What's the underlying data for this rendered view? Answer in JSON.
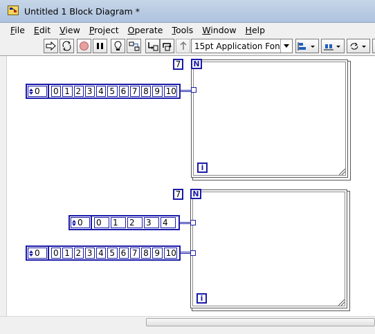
{
  "window": {
    "title": "Untitled 1 Block Diagram *"
  },
  "menu": {
    "items": [
      "File",
      "Edit",
      "View",
      "Project",
      "Operate",
      "Tools",
      "Window",
      "Help"
    ]
  },
  "toolbar": {
    "font": "15pt Application Font",
    "buttons": [
      "run-arrow-icon",
      "run-continuously-icon",
      "abort-icon",
      "pause-icon",
      "highlight-execution-icon",
      "retain-wire-values-icon",
      "step-into-icon",
      "step-over-icon",
      "step-out-icon",
      "text-settings-dropdown",
      "align-objects-icon",
      "distribute-objects-icon",
      "reorder-icon"
    ]
  },
  "diagram": {
    "loop1": {
      "count": "7",
      "n_label": "N",
      "i_label": "i",
      "array_index": "0",
      "array_values": [
        "0",
        "1",
        "2",
        "3",
        "4",
        "5",
        "6",
        "7",
        "8",
        "9",
        "10"
      ]
    },
    "loop2": {
      "count": "7",
      "n_label": "N",
      "i_label": "i",
      "array_a_index": "0",
      "array_a_values": [
        "0",
        "1",
        "2",
        "3",
        "4"
      ],
      "array_b_index": "0",
      "array_b_values": [
        "0",
        "1",
        "2",
        "3",
        "4",
        "5",
        "6",
        "7",
        "8",
        "9",
        "10"
      ]
    }
  },
  "colors": {
    "wire": "#1a1aa8",
    "titlebar": "#b9cbe2",
    "chrome": "#f0f0f0"
  }
}
